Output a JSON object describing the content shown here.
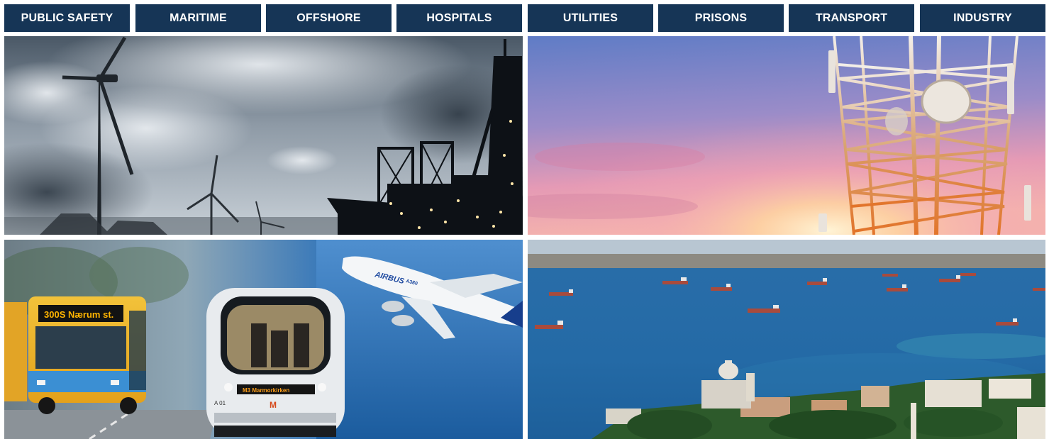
{
  "nav": {
    "items": [
      {
        "label": "PUBLIC SAFETY"
      },
      {
        "label": "MARITIME"
      },
      {
        "label": "OFFSHORE"
      },
      {
        "label": "HOSPITALS"
      },
      {
        "label": "UTILITIES"
      },
      {
        "label": "PRISONS"
      },
      {
        "label": "TRANSPORT"
      },
      {
        "label": "INDUSTRY"
      }
    ],
    "colors": {
      "background": "#163556",
      "text": "#ffffff"
    }
  },
  "photos": {
    "transport": {
      "bus_sign": "300S Nærum st.",
      "metro_sign": "M3 Marmorkirken",
      "metro_number": "A 01",
      "metro_logo": "M",
      "aircraft_livery": "AIRBUS",
      "aircraft_model": "A380"
    }
  }
}
